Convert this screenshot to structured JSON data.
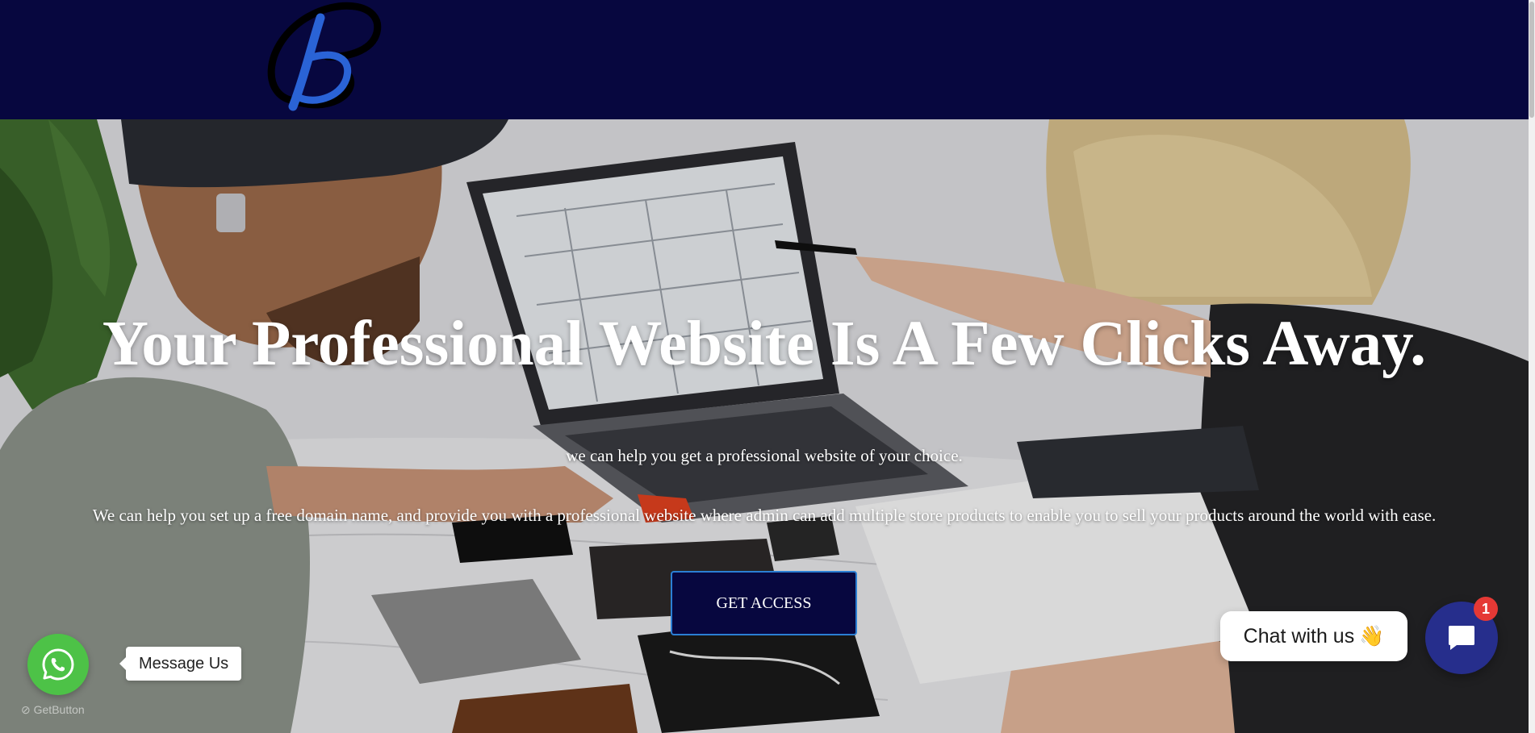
{
  "header": {
    "logo_icon": "cursive-b-logo",
    "background_color": "#07073f"
  },
  "hero": {
    "title": "Your Professional Website Is A Few Clicks Away.",
    "subtitle": "we can help you get a professional website of your choice.",
    "description": "We can help you set up a free domain name, and provide you with a professional website where admin can add multiple store products to enable you to sell your products around the world with ease.",
    "cta_label": "GET ACCESS",
    "background_image": "people-reviewing-website-plans-on-laptop"
  },
  "whatsapp": {
    "icon": "whatsapp-icon",
    "tooltip": "Message Us",
    "credit": "GetButton",
    "color": "#4dc247"
  },
  "chat": {
    "label": "Chat with us",
    "label_emoji": "👋",
    "badge_count": "1",
    "icon": "chat-bubble-icon",
    "launcher_color": "#262e8c",
    "badge_color": "#e53935"
  }
}
